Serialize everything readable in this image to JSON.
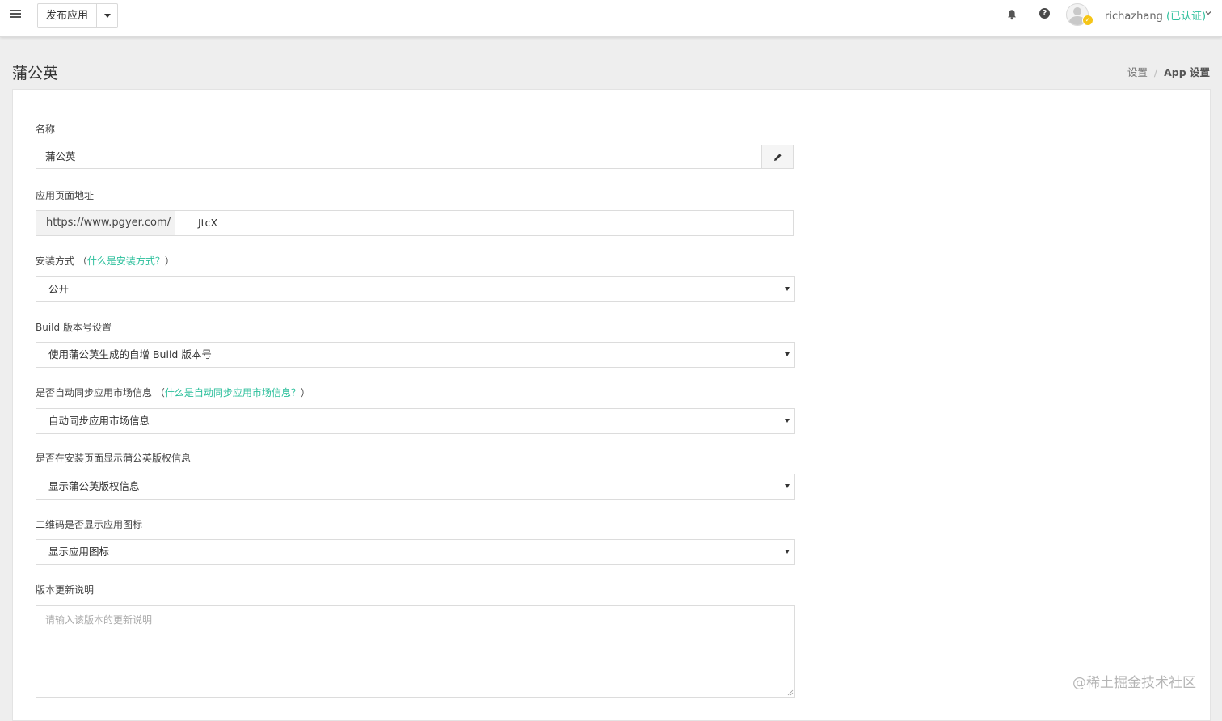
{
  "navbar": {
    "publish_label": "发布应用",
    "username": "richazhang",
    "verified_label": "(已认证)"
  },
  "header": {
    "title": "蒲公英",
    "breadcrumb": [
      "设置",
      "App 设置"
    ]
  },
  "form": {
    "name_label": "名称",
    "name_value": "蒲公英",
    "url_label": "应用页面地址",
    "url_prefix": "https://www.pgyer.com/",
    "url_slug": "JtcX",
    "install_label": "安装方式",
    "install_hint": "什么是安装方式？",
    "install_value": "公开",
    "build_label": "Build 版本号设置",
    "build_value": "使用蒲公英生成的自增 Build 版本号",
    "sync_label": "是否自动同步应用市场信息",
    "sync_hint": "什么是自动同步应用市场信息？",
    "sync_value": "自动同步应用市场信息",
    "copyright_label": "是否在安装页面显示蒲公英版权信息",
    "copyright_value": "显示蒲公英版权信息",
    "qrcode_label": "二维码是否显示应用图标",
    "qrcode_value": "显示应用图标",
    "notes_label": "版本更新说明",
    "notes_placeholder": "请输入该版本的更新说明"
  },
  "watermark": "@稀土掘金技术社区",
  "colors": {
    "accent": "#2bbf9b",
    "background": "#eeeeee",
    "panel": "#ffffff",
    "verified_badge": "#f5c518"
  },
  "icons": [
    "hamburger-menu-icon",
    "caret-down-icon",
    "bell-icon",
    "help-icon",
    "avatar-icon",
    "pencil-icon",
    "chevron-down-icon"
  ]
}
